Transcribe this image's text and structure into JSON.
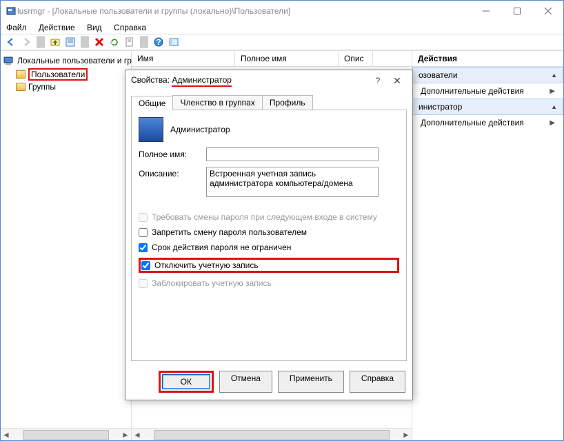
{
  "window": {
    "title": "lusrmgr - [Локальные пользователи и группы (локально)\\Пользователи]"
  },
  "menubar": {
    "file": "Файл",
    "action": "Действие",
    "view": "Вид",
    "help": "Справка"
  },
  "tree": {
    "root": "Локальные пользователи и гру",
    "users": "Пользователи",
    "groups": "Группы"
  },
  "columns": {
    "name": "Имя",
    "fullname": "Полное имя",
    "desc": "Опис"
  },
  "actions": {
    "header": "Действия",
    "section1": "озователи",
    "more": "Дополнительные действия",
    "section2": "инистратор"
  },
  "dialog": {
    "title_prefix": "Свойства: ",
    "title_name": "Администратор",
    "tabs": {
      "general": "Общие",
      "membership": "Членство в группах",
      "profile": "Профиль"
    },
    "username": "Администратор",
    "fullname_label": "Полное имя:",
    "fullname_value": "",
    "desc_label": "Описание:",
    "desc_value": "Встроенная учетная запись администратора компьютера/домена",
    "chk_require_change": "Требовать смены пароля при следующем входе в систему",
    "chk_no_change": "Запретить смену пароля пользователем",
    "chk_never_expire": "Срок действия пароля не ограничен",
    "chk_disable": "Отключить учетную запись",
    "chk_lock": "Заблокировать учетную запись",
    "buttons": {
      "ok": "ОК",
      "cancel": "Отмена",
      "apply": "Применить",
      "help": "Справка"
    }
  }
}
